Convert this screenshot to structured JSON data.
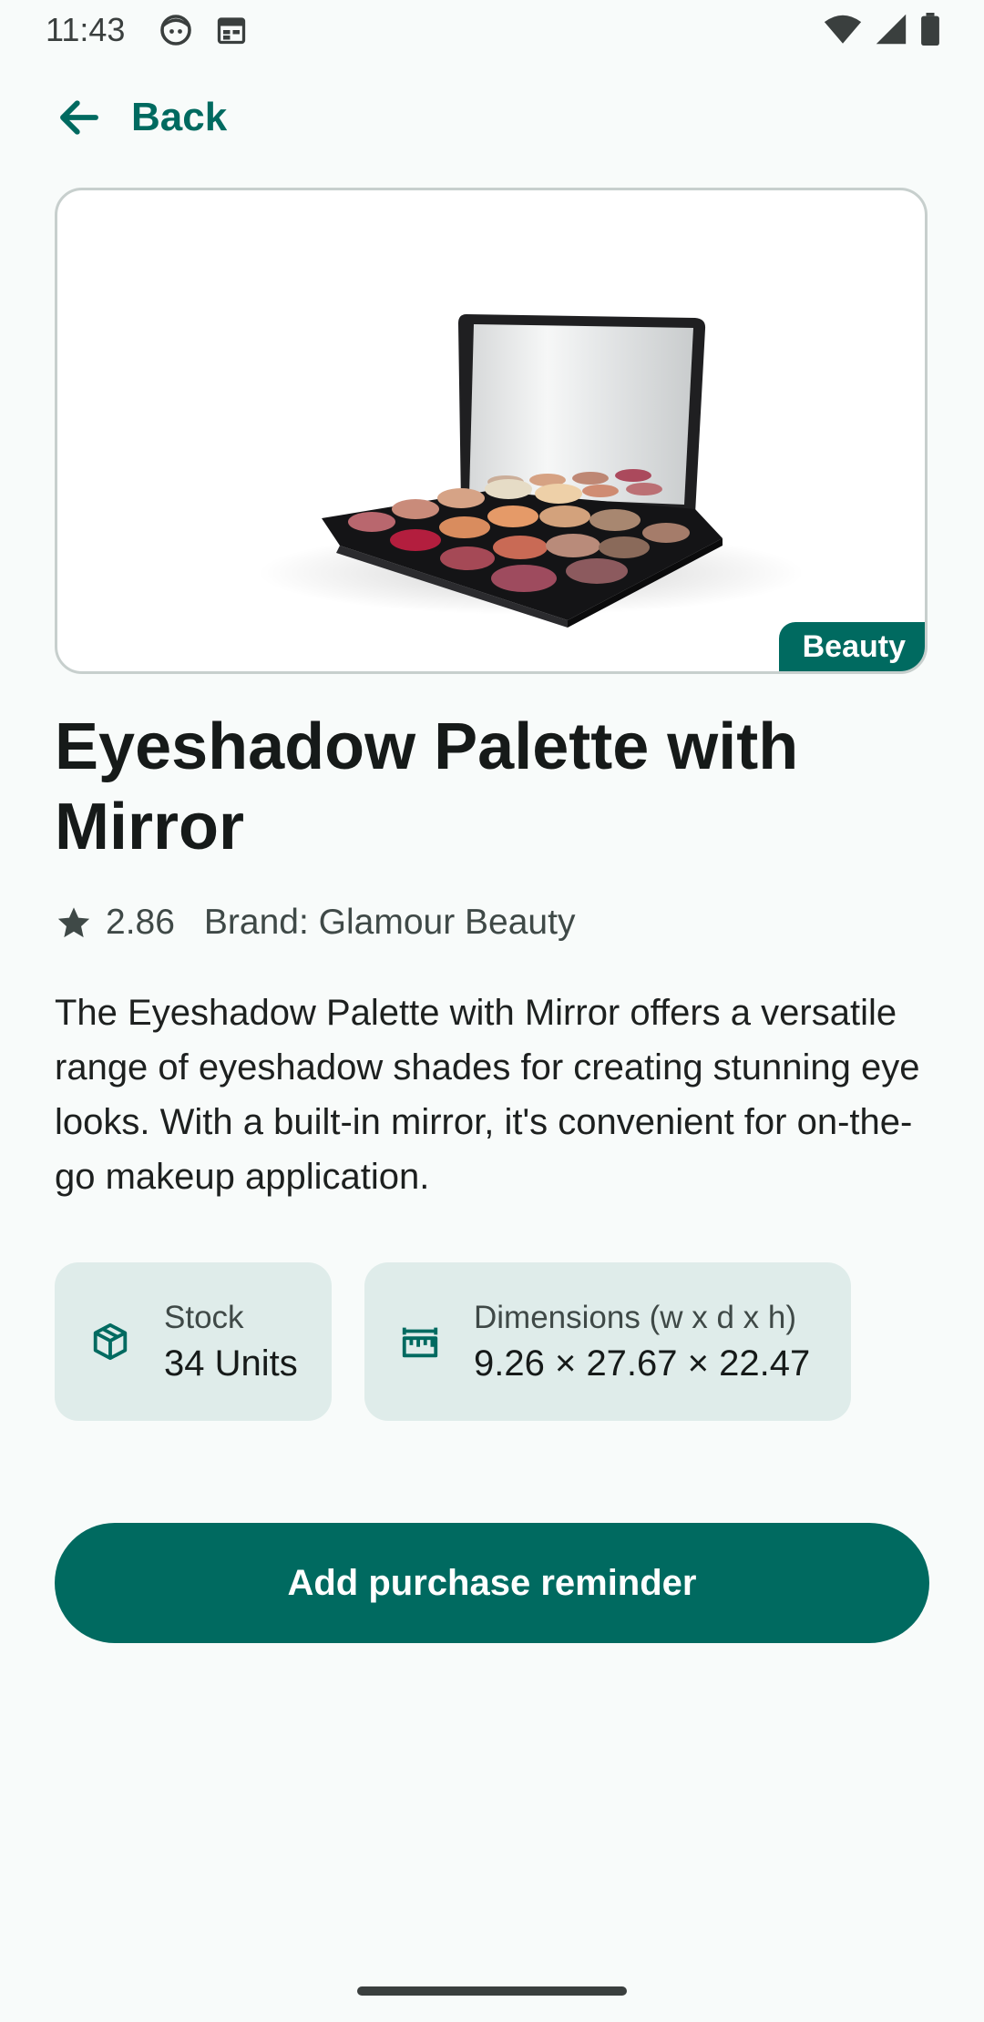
{
  "status_bar": {
    "time": "11:43",
    "left_icons": [
      "face-icon",
      "calendar-icon"
    ],
    "right_icons": [
      "wifi-icon",
      "signal-icon",
      "battery-icon"
    ]
  },
  "nav": {
    "back_label": "Back",
    "back_icon": "arrow-left-icon"
  },
  "product": {
    "image_subject": "eyeshadow-palette-with-mirror",
    "category": "Beauty",
    "title": "Eyeshadow Palette with Mirror",
    "rating": "2.86",
    "brand": "Brand: Glamour Beauty",
    "description": "The Eyeshadow Palette with Mirror offers a versatile range of eyeshadow shades for creating stunning eye looks. With a built-in mirror, it's convenient for on-the-go makeup application.",
    "stock": {
      "label": "Stock",
      "value": "34 Units",
      "icon": "box-icon"
    },
    "dimensions": {
      "label": "Dimensions (w x d x h)",
      "value": "9.26 × 27.67 × 22.47",
      "icon": "ruler-icon"
    }
  },
  "actions": {
    "reminder_label": "Add purchase reminder"
  },
  "colors": {
    "accent": "#006a60",
    "chip_bg": "#dfecea",
    "background": "#f8fbfa"
  }
}
